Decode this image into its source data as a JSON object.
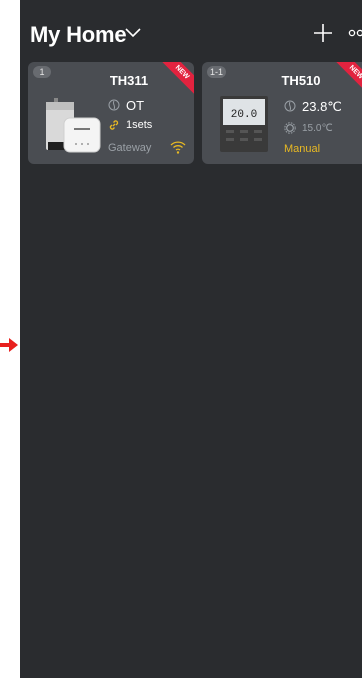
{
  "header": {
    "home_label": "My Home"
  },
  "devices": [
    {
      "index": "1",
      "badge": "NEW",
      "name": "TH311",
      "mode": "OT",
      "link_info": "1sets",
      "type_label": "Gateway"
    },
    {
      "index": "1-1",
      "badge": "NEW",
      "name": "TH510",
      "current_temp": "23.8℃",
      "set_temp": "15.0℃",
      "mode_label": "Manual",
      "display_temp": "20.0"
    }
  ],
  "colors": {
    "background": "#2a2c2f",
    "card": "#4a4d52",
    "badge": "#e2233f",
    "accent_yellow": "#e8b923",
    "muted": "#9aa0a6",
    "arrow": "#e8201e"
  }
}
